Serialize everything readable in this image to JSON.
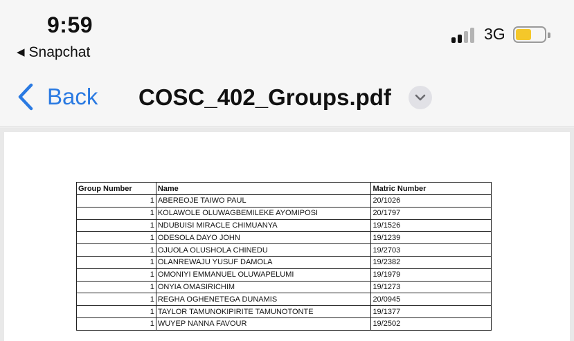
{
  "status_bar": {
    "time": "9:59",
    "back_app_label": "Snapchat",
    "network": "3G",
    "battery_level": 0.55,
    "battery_color": "#f4c72a"
  },
  "nav_bar": {
    "back_label": "Back",
    "title": "COSC_402_Groups.pdf",
    "accent_color": "#2a7ae2"
  },
  "document": {
    "columns": [
      "Group Number",
      "Name",
      "Matric Number"
    ],
    "rows": [
      {
        "group": "1",
        "name": "ABEREOJE TAIWO PAUL",
        "matric": "20/1026"
      },
      {
        "group": "1",
        "name": "KOLAWOLE OLUWAGBEMILEKE AYOMIPOSI",
        "matric": "20/1797"
      },
      {
        "group": "1",
        "name": "NDUBUISI MIRACLE CHIMUANYA",
        "matric": "19/1526"
      },
      {
        "group": "1",
        "name": "ODESOLA DAYO JOHN",
        "matric": "19/1239"
      },
      {
        "group": "1",
        "name": "OJUOLA OLUSHOLA CHINEDU",
        "matric": "19/2703"
      },
      {
        "group": "1",
        "name": "OLANREWAJU YUSUF DAMOLA",
        "matric": "19/2382"
      },
      {
        "group": "1",
        "name": "OMONIYI EMMANUEL OLUWAPELUMI",
        "matric": "19/1979"
      },
      {
        "group": "1",
        "name": "ONYIA OMASIRICHIM",
        "matric": "19/1273"
      },
      {
        "group": "1",
        "name": "REGHA OGHENETEGA DUNAMIS",
        "matric": "20/0945"
      },
      {
        "group": "1",
        "name": "TAYLOR TAMUNOKIPIRITE TAMUNOTONTE",
        "matric": "19/1377"
      },
      {
        "group": "1",
        "name": "WUYEP NANNA FAVOUR",
        "matric": "19/2502"
      }
    ]
  }
}
